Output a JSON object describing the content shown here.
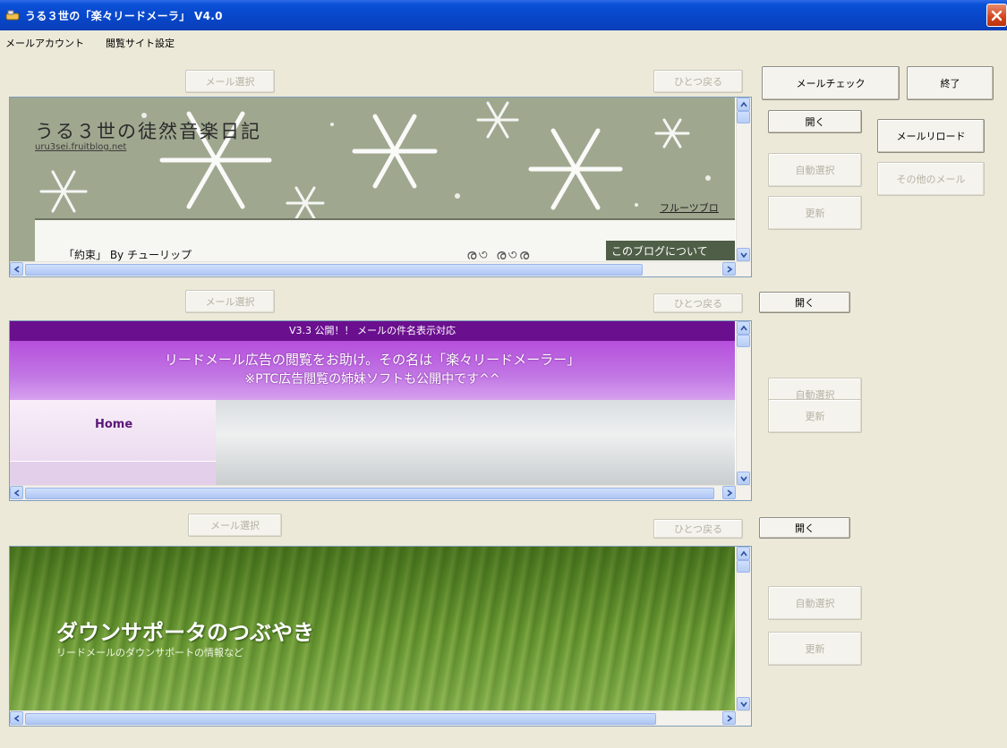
{
  "window": {
    "title": "うる３世の「楽々リードメーラ」 V4.0"
  },
  "menu": {
    "items": [
      "メールアカウント",
      "閲覧サイト設定"
    ]
  },
  "controls": {
    "mail_check": "メールチェック",
    "exit": "終了",
    "open": "開く",
    "mail_reload": "メールリロード",
    "auto_select": "自動選択",
    "other_mail": "その他のメール",
    "update": "更新",
    "mail_select": "メール選択",
    "back_one": "ひとつ戻る"
  },
  "panes": [
    {
      "blog_title": "うる３世の徒然音楽日記",
      "blog_url": "uru3sei.fruitblog.net",
      "fruit_link": "フルーツブロ",
      "song": "「約束」 By チューリップ",
      "about": "このブログについて"
    },
    {
      "top_bar": "V3.3 公開！！ メールの件名表示対応",
      "banner_line1": "リードメール広告の閲覧をお助け。その名は「楽々リードメーラー」",
      "banner_line2": "※PTC広告閲覧の姉妹ソフトも公開中です^^",
      "nav_home": "Home"
    },
    {
      "title": "ダウンサポータのつぶやき",
      "subtitle": "リードメールのダウンサポートの情報など"
    }
  ],
  "colors": {
    "titlebar": "#0846c8",
    "window_bg": "#ece9d8",
    "pane2_purple": "#6a0f8e",
    "pane3_green": "#5c8a2a"
  }
}
